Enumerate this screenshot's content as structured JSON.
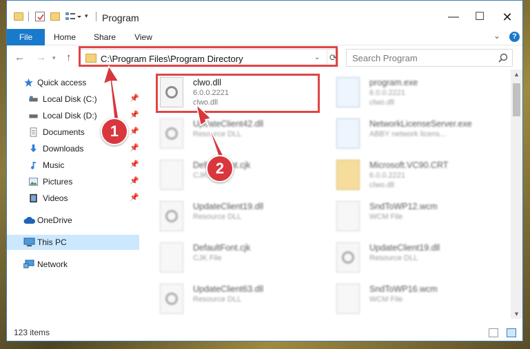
{
  "window": {
    "title": "Program",
    "controls": {
      "minimize": "—",
      "maximize": "☐",
      "close": "✕"
    }
  },
  "ribbon": {
    "tabs": [
      {
        "label": "File",
        "active": true
      },
      {
        "label": "Home"
      },
      {
        "label": "Share"
      },
      {
        "label": "View"
      }
    ],
    "help": "?"
  },
  "navigation": {
    "address_path": "C:\\Program Files\\Program Directory",
    "search_placeholder": "Search Program"
  },
  "sidebar": {
    "items": [
      {
        "label": "Quick access",
        "icon": "star-icon",
        "pinned": false
      },
      {
        "label": "Local Disk (C:)",
        "icon": "drive-icon",
        "pinned": true
      },
      {
        "label": "Local Disk (D:)",
        "icon": "drive-icon",
        "pinned": true
      },
      {
        "label": "Documents",
        "icon": "documents-icon",
        "pinned": true
      },
      {
        "label": "Downloads",
        "icon": "download-icon",
        "pinned": true
      },
      {
        "label": "Music",
        "icon": "music-icon",
        "pinned": true
      },
      {
        "label": "Pictures",
        "icon": "pictures-icon",
        "pinned": true
      },
      {
        "label": "Videos",
        "icon": "videos-icon",
        "pinned": true
      },
      {
        "label": "OneDrive",
        "icon": "cloud-icon",
        "pinned": false
      },
      {
        "label": "This PC",
        "icon": "computer-icon",
        "pinned": false,
        "selected": true
      },
      {
        "label": "Network",
        "icon": "network-icon",
        "pinned": false
      }
    ]
  },
  "files": [
    {
      "name": "clwo.dll",
      "line1": "6.0.0.2221",
      "line2": "clwo.dll",
      "type": "dll",
      "highlighted": true
    },
    {
      "name": "program.exe",
      "line1": "6.0.0.2221",
      "line2": "clwo.dll",
      "type": "exe"
    },
    {
      "name": "UpdateClient42.dll",
      "line1": "Resource DLL",
      "line2": "",
      "type": "dll"
    },
    {
      "name": "NetworkLicenseServer.exe",
      "line1": "ABBY network licens...",
      "line2": "",
      "type": "exe"
    },
    {
      "name": "DefaultFont.cjk",
      "line1": "CJK File",
      "line2": "",
      "type": "file"
    },
    {
      "name": "Microsoft.VC90.CRT",
      "line1": "6.0.0.2221",
      "line2": "clwo.dll",
      "type": "folder"
    },
    {
      "name": "UpdateClient19.dll",
      "line1": "Resource DLL",
      "line2": "",
      "type": "dll"
    },
    {
      "name": "SndToWP12.wcm",
      "line1": "WCM File",
      "line2": "",
      "type": "file"
    },
    {
      "name": "DefaultFont.cjk",
      "line1": "CJK File",
      "line2": "",
      "type": "file"
    },
    {
      "name": "UpdateClient19.dll",
      "line1": "Resource DLL",
      "line2": "",
      "type": "dll"
    },
    {
      "name": "UpdateClient63.dll",
      "line1": "Resource DLL",
      "line2": "",
      "type": "dll"
    },
    {
      "name": "SndToWP16.wcm",
      "line1": "WCM File",
      "line2": "",
      "type": "file"
    }
  ],
  "status": {
    "count_text": "123 items"
  },
  "annotations": [
    {
      "label": "1",
      "color": "#d9363e"
    },
    {
      "label": "2",
      "color": "#d9363e"
    }
  ]
}
